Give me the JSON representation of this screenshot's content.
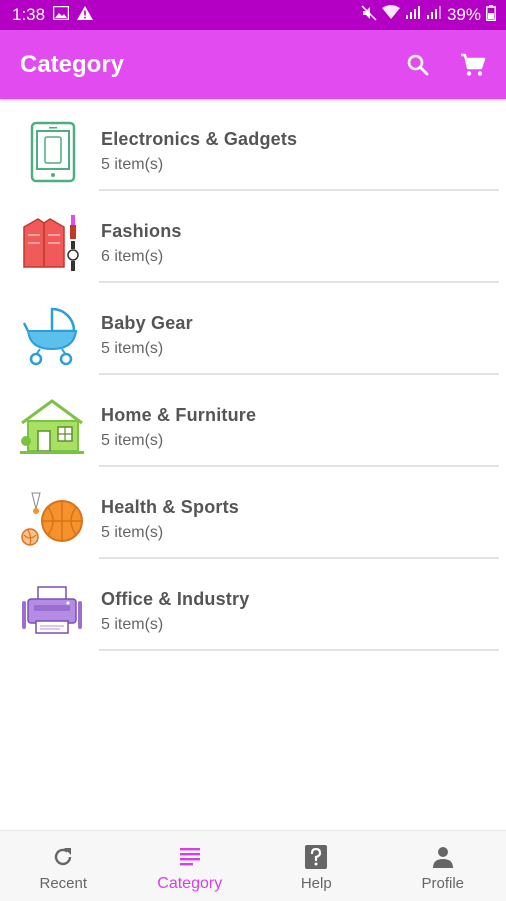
{
  "status_bar": {
    "time": "1:38",
    "battery": "39%"
  },
  "app_bar": {
    "title": "Category",
    "search_icon": "search-icon",
    "cart_icon": "cart-icon"
  },
  "categories": [
    {
      "title": "Electronics & Gadgets",
      "count": "5 item(s)",
      "icon": "tablet-icon"
    },
    {
      "title": "Fashions",
      "count": "6 item(s)",
      "icon": "fashion-icon"
    },
    {
      "title": "Baby Gear",
      "count": "5 item(s)",
      "icon": "stroller-icon"
    },
    {
      "title": "Home & Furniture",
      "count": "5 item(s)",
      "icon": "house-icon"
    },
    {
      "title": "Health & Sports",
      "count": "5 item(s)",
      "icon": "sports-icon"
    },
    {
      "title": "Office & Industry",
      "count": "5 item(s)",
      "icon": "printer-icon"
    }
  ],
  "bottom_nav": [
    {
      "label": "Recent",
      "icon": "refresh-icon",
      "active": false
    },
    {
      "label": "Category",
      "icon": "list-icon",
      "active": true
    },
    {
      "label": "Help",
      "icon": "help-icon",
      "active": false
    },
    {
      "label": "Profile",
      "icon": "person-icon",
      "active": false
    }
  ],
  "colors": {
    "status_bar": "#b300c4",
    "app_bar": "#e14bf0",
    "active_nav": "#d63ee8"
  }
}
